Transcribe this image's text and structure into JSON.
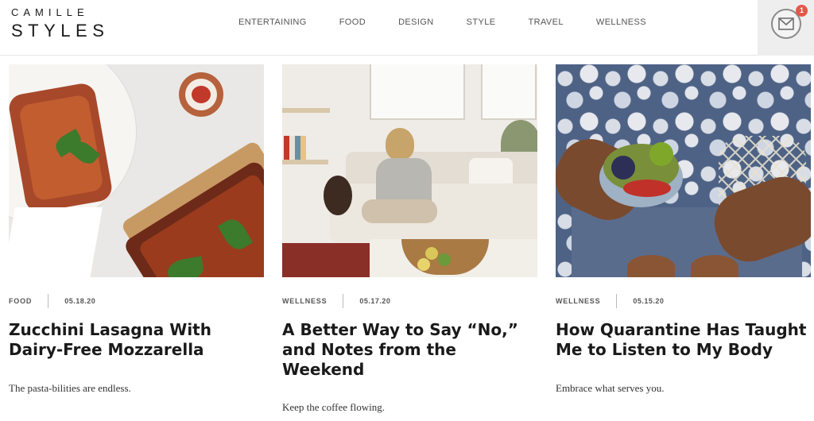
{
  "header": {
    "logo_top": "CAMILLE",
    "logo_bottom": "STYLES",
    "nav": [
      {
        "label": "ENTERTAINING"
      },
      {
        "label": "FOOD"
      },
      {
        "label": "DESIGN"
      },
      {
        "label": "STYLE"
      },
      {
        "label": "TRAVEL"
      },
      {
        "label": "WELLNESS"
      }
    ],
    "mail_badge": "1",
    "mail_icon": "envelope-icon"
  },
  "posts": [
    {
      "category": "FOOD",
      "date": "05.18.20",
      "title": "Zucchini Lasagna With Dairy-Free Mozzarella",
      "excerpt": "The pasta-bilities are endless."
    },
    {
      "category": "WELLNESS",
      "date": "05.17.20",
      "title": "A Better Way to Say “No,” and Notes from the Weekend",
      "excerpt": "Keep the coffee flowing."
    },
    {
      "category": "WELLNESS",
      "date": "05.15.20",
      "title": "How Quarantine Has Taught Me to Listen to My Body",
      "excerpt": "Embrace what serves you."
    }
  ],
  "colors": {
    "badge": "#e4584a",
    "text": "#1a1a1a",
    "meta": "#555555"
  }
}
